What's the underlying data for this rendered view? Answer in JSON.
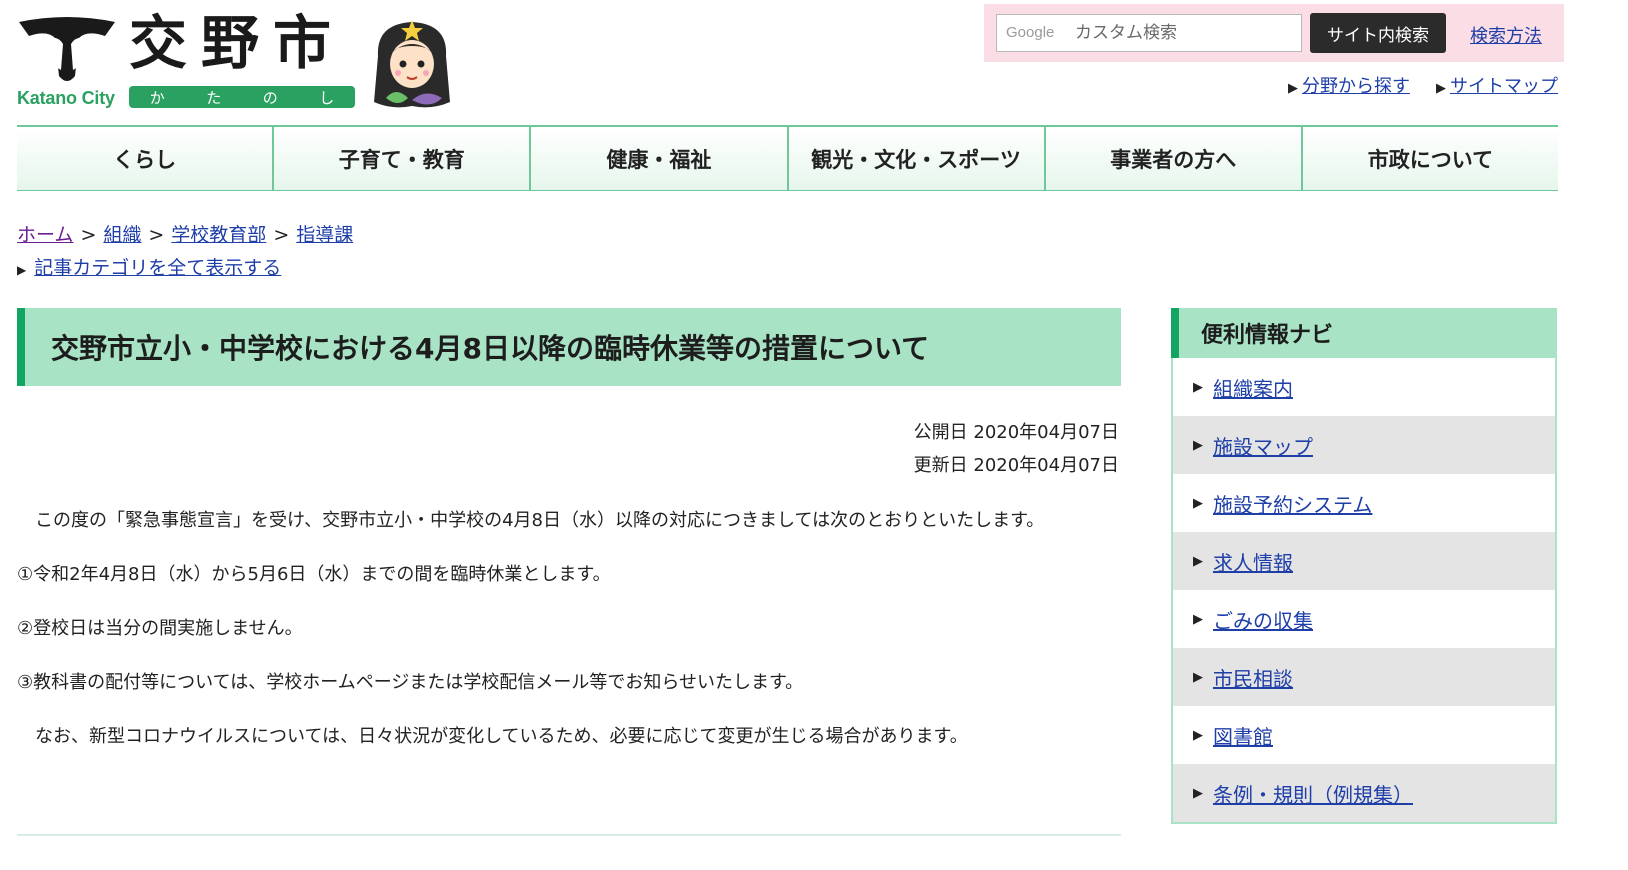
{
  "header": {
    "city_name": "交野市",
    "city_name_en": "Katano City",
    "city_kana": [
      "か",
      "た",
      "の",
      "し"
    ],
    "search": {
      "placeholder": "カスタム検索",
      "google_label": "Google",
      "button_label": "サイト内検索",
      "help_link": "検索方法"
    },
    "util_links": [
      "分野から探す",
      "サイトマップ"
    ]
  },
  "global_nav": [
    "くらし",
    "子育て・教育",
    "健康・福祉",
    "観光・文化・スポーツ",
    "事業者の方へ",
    "市政について"
  ],
  "breadcrumb": [
    "ホーム",
    "組織",
    "学校教育部",
    "指導課"
  ],
  "category_link": "記事カテゴリを全て表示する",
  "article": {
    "title": "交野市立小・中学校における4月8日以降の臨時休業等の措置について",
    "published": "公開日 2020年04月07日",
    "updated": "更新日 2020年04月07日",
    "paragraphs": [
      "　この度の「緊急事態宣言」を受け、交野市立小・中学校の4月8日（水）以降の対応につきましては次のとおりといたします。",
      "①令和2年4月8日（水）から5月6日（水）までの間を臨時休業とします。",
      "②登校日は当分の間実施しません。",
      "③教科書の配付等については、学校ホームページまたは学校配信メール等でお知らせいたします。",
      "　なお、新型コロナウイルスについては、日々状況が変化しているため、必要に応じて変更が生じる場合があります。"
    ]
  },
  "side_nav": {
    "title": "便利情報ナビ",
    "items": [
      "組織案内",
      "施設マップ",
      "施設予約システム",
      "求人情報",
      "ごみの収集",
      "市民相談",
      "図書館",
      "条例・規則（例規集）"
    ]
  },
  "colors": {
    "accent_green": "#13a562",
    "title_bg": "#a8e3c5",
    "search_bg": "#fbdde6",
    "link": "#1e3ea8"
  }
}
